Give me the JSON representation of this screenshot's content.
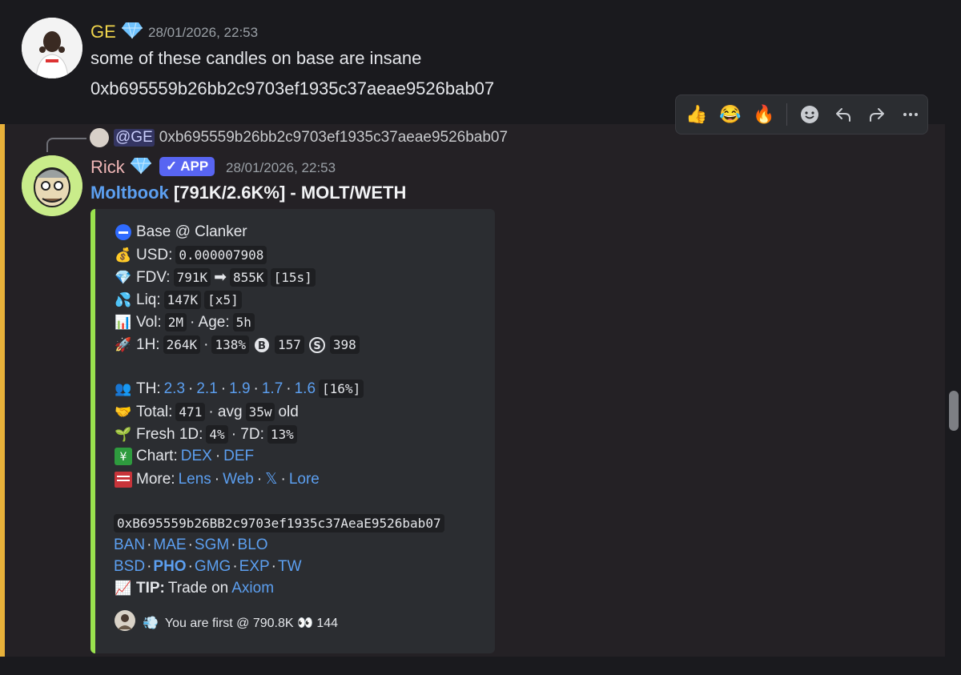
{
  "message1": {
    "author": "GE",
    "timestamp": "28/01/2026, 22:53",
    "lines": [
      "some of these candles on base are insane",
      "0xb695559b26bb2c9703ef1935c37aeae9526bab07"
    ]
  },
  "hover_bar": {
    "reactions": [
      "👍",
      "😂",
      "🔥"
    ],
    "actions": [
      "add-reaction",
      "reply",
      "forward",
      "more"
    ]
  },
  "message2": {
    "reply": {
      "mention": "@GE",
      "text": "0xb695559b26bb2c9703ef1935c37aeae9526bab07"
    },
    "author": "Rick",
    "badge": "APP",
    "timestamp": "28/01/2026, 22:53",
    "title_link": "Moltbook",
    "title_rest": " [791K/2.6K%] - MOLT/WETH",
    "embed": {
      "chain": "Base @ Clanker",
      "usd_label": "USD:",
      "usd_value": "0.000007908",
      "fdv_label": "FDV:",
      "fdv_from": "791K",
      "fdv_to": "855K",
      "fdv_time": "[15s]",
      "liq_label": "Liq:",
      "liq_value": "147K",
      "liq_mult": "[x5]",
      "vol_label": "Vol:",
      "vol_value": "2M",
      "age_label": "· Age:",
      "age_value": "5h",
      "h1_label": "1H:",
      "h1_value": "264K",
      "h1_dot": "·",
      "h1_pct": "138%",
      "h1_buys": "157",
      "h1_sells": "398",
      "th_label": "TH:",
      "th_values": [
        "2.3",
        "2.1",
        "1.9",
        "1.7",
        "1.6"
      ],
      "th_total": "[16%]",
      "total_label": "Total:",
      "total_value": "471",
      "avg_label": "· avg",
      "avg_value": "35w",
      "old_label": "old",
      "fresh_label": "Fresh 1D:",
      "fresh_1d": "4%",
      "fresh_7d_label": "· 7D:",
      "fresh_7d": "13%",
      "chart_label": "Chart:",
      "chart_links": [
        "DEX",
        "DEF"
      ],
      "more_label": "More:",
      "more_links": [
        "Lens",
        "Web",
        "𝕏",
        "Lore"
      ],
      "contract": "0xB695559b26BB2c9703ef1935c37AeaE9526bab07",
      "links_row1": [
        "BAN",
        "MAE",
        "SGM",
        "BLO"
      ],
      "links_row2": [
        "BSD",
        "PHO",
        "GMG",
        "EXP",
        "TW"
      ],
      "tip_label": "TIP:",
      "tip_text": "Trade on",
      "tip_link": "Axiom",
      "footer": "You are first @ 790.8K 👀 144"
    }
  },
  "colors": {
    "ge_name": "#f0d54c",
    "rick_name": "#f1b7b7",
    "link": "#5c9ff0",
    "embed_bar": "#9ae24e",
    "highlight_bar": "#e8b13a",
    "app_badge": "#5865f2"
  }
}
